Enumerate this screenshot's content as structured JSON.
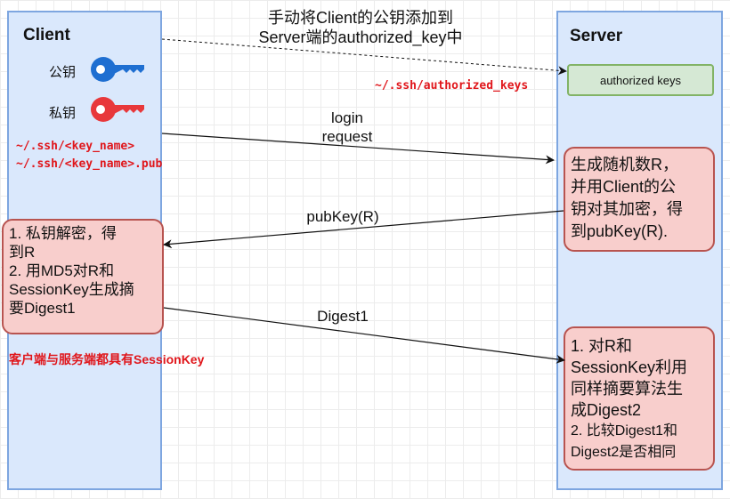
{
  "client": {
    "title": "Client",
    "public_key_label": "公钥",
    "private_key_label": "私钥",
    "key_paths": [
      "~/.ssh/<key_name>",
      "~/.ssh/<key_name>.pub"
    ],
    "decrypt_box": [
      "1. 私钥解密，得",
      "到R",
      "2. 用MD5对R和",
      "SessionKey生成摘",
      "要Digest1"
    ],
    "session_note": "客户端与服务端都具有SessionKey"
  },
  "server": {
    "title": "Server",
    "authorized_keys_box": "authorized keys",
    "authorized_keys_path": "~/.ssh/authorized_keys",
    "encrypt_box": [
      "生成随机数R，",
      "并用Client的公",
      "钥对其加密，得",
      "到pubKey(R)."
    ],
    "verify_box": [
      "1. 对R和",
      "SessionKey利用",
      "同样摘要算法生",
      "成Digest2",
      "2. 比较Digest1和",
      "Digest2是否相同"
    ]
  },
  "messages": {
    "add_key": [
      "手动将Client的公钥添加到",
      "Server端的authorized_key中"
    ],
    "login_request": [
      "login",
      "request"
    ],
    "pubkey_reply": "pubKey(R)",
    "digest1": "Digest1"
  },
  "colors": {
    "lane_fill": "#dae8fc",
    "lane_border": "#7ea6e0",
    "public_key": "#1f6fd1",
    "private_key": "#e8383b",
    "box_fill": "#f8cecc",
    "box_border": "#b85450",
    "green_fill": "#d5e8d4",
    "green_border": "#82b366",
    "path_text": "#e0161b"
  }
}
